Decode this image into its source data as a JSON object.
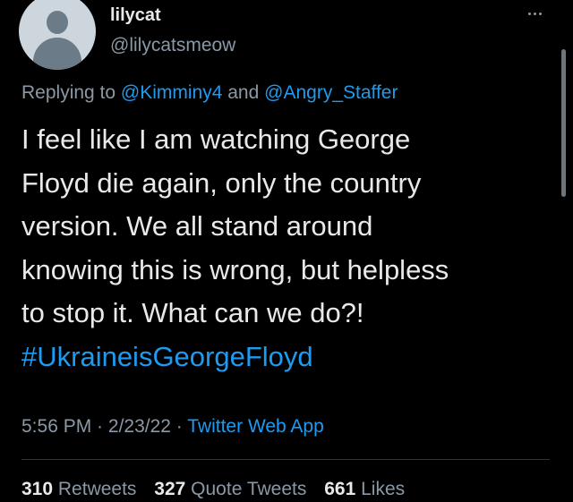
{
  "author": {
    "display_name": "lilycat",
    "handle": "@lilycatsmeow"
  },
  "more_icon": "more-horizontal-icon",
  "reply_context": {
    "prefix": "Replying to ",
    "mention_1": "@Kimminy4",
    "conjunction": " and ",
    "mention_2": "@Angry_Staffer"
  },
  "tweet": {
    "lines": [
      "I feel like I am watching George",
      "Floyd die again, only the country",
      "version.  We all stand around",
      "knowing this is wrong, but helpless",
      "to stop it.  What can we do?!"
    ],
    "hashtag": "#UkraineisGeorgeFloyd"
  },
  "meta": {
    "time": "5:56 PM",
    "separator": " · ",
    "date": "2/23/22",
    "source": "Twitter Web App"
  },
  "stats": {
    "retweets_count": "310",
    "retweets_label": "Retweets",
    "quote_count": "327",
    "quote_label": "Quote Tweets",
    "likes_count": "661",
    "likes_label": "Likes"
  },
  "colors": {
    "background": "#000000",
    "text_primary": "#e7e9ea",
    "text_secondary": "#8b98a5",
    "link": "#1d9bf0"
  }
}
